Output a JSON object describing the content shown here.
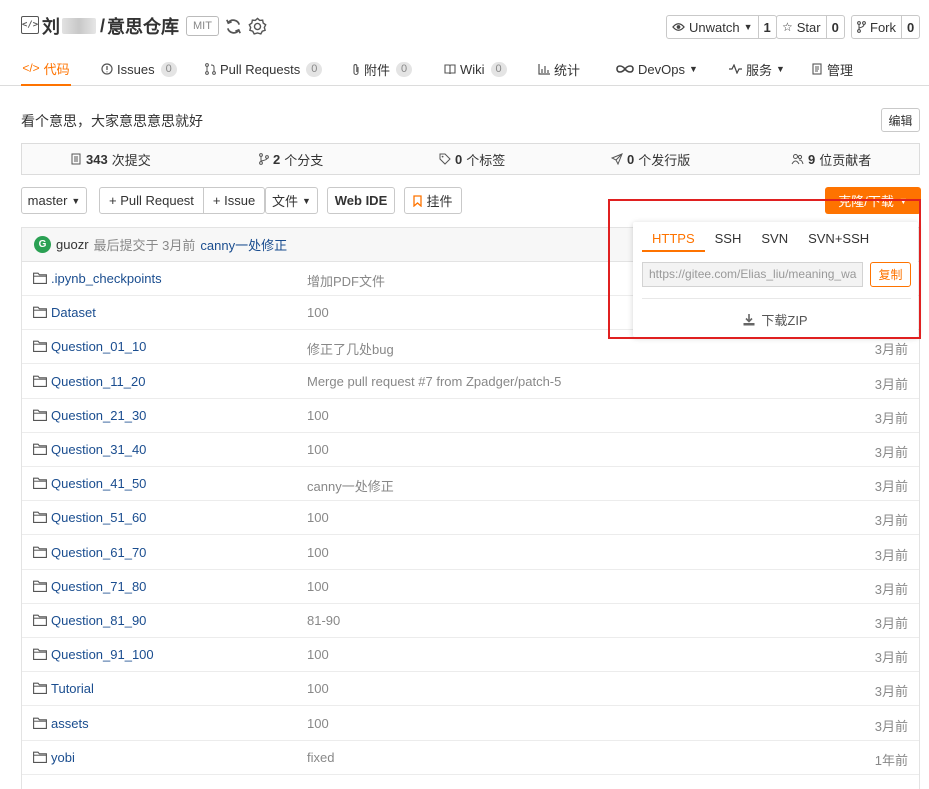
{
  "repo": {
    "owner": "刘",
    "separator": "/",
    "name": "意思仓库",
    "license": "MIT"
  },
  "header_buttons": {
    "watch_label": "Unwatch",
    "watch_count": "1",
    "star_label": "Star",
    "star_count": "0",
    "fork_label": "Fork",
    "fork_count": "0"
  },
  "tabs": [
    {
      "label": "代码",
      "icon": "code-icon"
    },
    {
      "label": "Issues",
      "count": "0",
      "icon": "issue-icon"
    },
    {
      "label": "Pull Requests",
      "count": "0",
      "icon": "pull-request-icon"
    },
    {
      "label": "附件",
      "count": "0",
      "icon": "paperclip-icon"
    },
    {
      "label": "Wiki",
      "count": "0",
      "icon": "book-icon"
    },
    {
      "label": "统计",
      "icon": "chart-icon"
    },
    {
      "label": "DevOps",
      "icon": "infinity-icon"
    },
    {
      "label": "服务",
      "icon": "pulse-icon"
    },
    {
      "label": "管理",
      "icon": "manage-icon"
    }
  ],
  "description": "看个意思，大家意思意思就好",
  "edit_label": "编辑",
  "stats": {
    "commits_count": "343",
    "commits_label": "次提交",
    "branches_count": "2",
    "branches_label": "个分支",
    "tags_count": "0",
    "tags_label": "个标签",
    "releases_count": "0",
    "releases_label": "个发行版",
    "contributors_count": "9",
    "contributors_label": "位贡献者"
  },
  "toolbar": {
    "branch": "master",
    "pull_request": "+ Pull Request",
    "issue": "+ Issue",
    "file": "文件",
    "web_ide": "Web IDE",
    "widget": "挂件",
    "clone": "克隆/下载"
  },
  "latest_commit": {
    "avatar_letter": "G",
    "author": "guozr",
    "meta": "最后提交于 3月前",
    "message": "canny一处修正"
  },
  "files": [
    {
      "name": ".ipynb_checkpoints",
      "message": "增加PDF文件",
      "time": ""
    },
    {
      "name": "Dataset",
      "message": "100",
      "time": ""
    },
    {
      "name": "Question_01_10",
      "message": "修正了几处bug",
      "time": "3月前"
    },
    {
      "name": "Question_11_20",
      "message": "Merge pull request #7 from Zpadger/patch-5",
      "time": "3月前"
    },
    {
      "name": "Question_21_30",
      "message": "100",
      "time": "3月前"
    },
    {
      "name": "Question_31_40",
      "message": "100",
      "time": "3月前"
    },
    {
      "name": "Question_41_50",
      "message": "canny一处修正",
      "time": "3月前"
    },
    {
      "name": "Question_51_60",
      "message": "100",
      "time": "3月前"
    },
    {
      "name": "Question_61_70",
      "message": "100",
      "time": "3月前"
    },
    {
      "name": "Question_71_80",
      "message": "100",
      "time": "3月前"
    },
    {
      "name": "Question_81_90",
      "message": "81-90",
      "time": "3月前"
    },
    {
      "name": "Question_91_100",
      "message": "100",
      "time": "3月前"
    },
    {
      "name": "Tutorial",
      "message": "100",
      "time": "3月前"
    },
    {
      "name": "assets",
      "message": "100",
      "time": "3月前"
    },
    {
      "name": "yobi",
      "message": "fixed",
      "time": "1年前"
    }
  ],
  "clone_dropdown": {
    "tabs": [
      "HTTPS",
      "SSH",
      "SVN",
      "SVN+SSH"
    ],
    "active_tab": "HTTPS",
    "url": "https://gitee.com/Elias_liu/meaning_wa",
    "copy_label": "复制",
    "download_zip": "下载ZIP"
  },
  "colors": {
    "accent": "#fe7300",
    "link": "#1a4d8f",
    "highlight_border": "#e02020"
  }
}
